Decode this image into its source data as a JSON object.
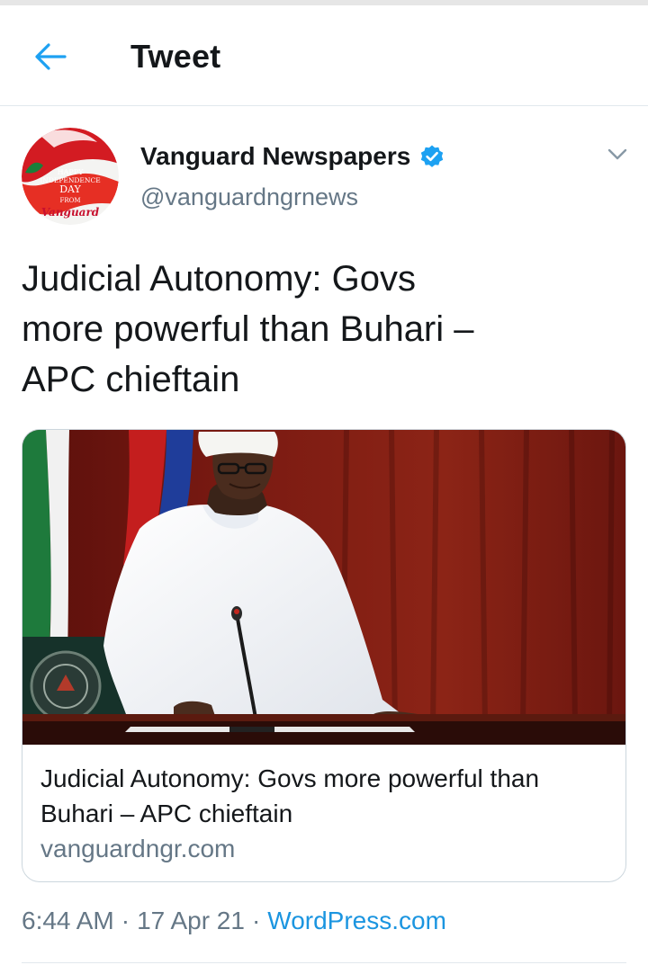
{
  "header": {
    "title": "Tweet",
    "back_icon": "arrow-left-icon"
  },
  "tweet": {
    "author": {
      "name": "Vanguard Newspapers",
      "handle": "@vanguardngrnews",
      "verified_icon": "verified-badge-icon",
      "avatar_text": [
        "HAPPY",
        "INDEPENDENCE",
        "DAY",
        "FROM",
        "Vanguard"
      ]
    },
    "text_lines": [
      "Judicial Autonomy: Govs",
      "more powerful than Buhari –",
      "APC chieftain"
    ],
    "card": {
      "title_lines": [
        "Judicial Autonomy: Govs more powerful than",
        "Buhari – APC chieftain"
      ],
      "domain": "vanguardngr.com"
    },
    "meta": {
      "time": "6:44 AM",
      "date": "17 Apr 21",
      "separator": "·",
      "source": "WordPress.com"
    }
  },
  "colors": {
    "accent": "#1b95e0",
    "secondary_text": "#657786",
    "border": "#e1e8ed"
  }
}
